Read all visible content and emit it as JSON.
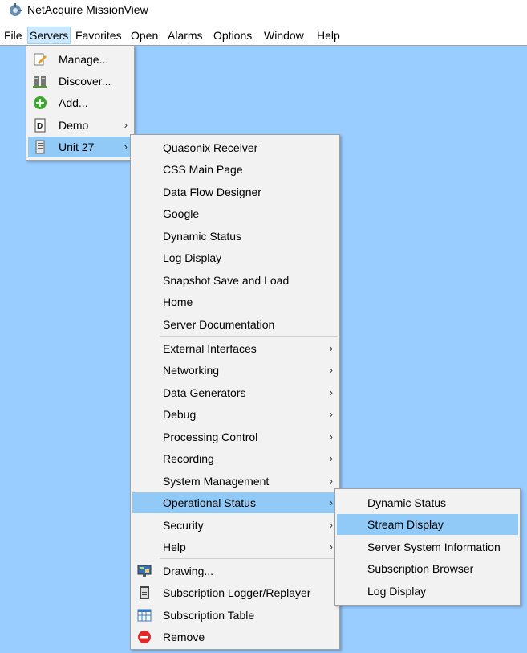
{
  "window": {
    "title": "NetAcquire MissionView"
  },
  "menubar": [
    "File",
    "Servers",
    "Favorites",
    "Open",
    "Alarms",
    "Options",
    "Window",
    "Help"
  ],
  "servers_menu": {
    "items": [
      {
        "label": "Manage...",
        "icon": "manage-icon"
      },
      {
        "label": "Discover...",
        "icon": "discover-icon"
      },
      {
        "label": "Add...",
        "icon": "add-icon"
      },
      {
        "label": "Demo",
        "icon": "demo-icon",
        "submenu": true
      },
      {
        "label": "Unit 27",
        "icon": "unit-icon",
        "submenu": true,
        "highlighted": true
      }
    ]
  },
  "unit_menu": {
    "group1": [
      "Quasonix Receiver",
      "CSS Main Page",
      "Data Flow Designer",
      "Google",
      "Dynamic Status",
      "Log Display",
      "Snapshot Save and Load",
      "Home",
      "Server Documentation"
    ],
    "group2": [
      "External Interfaces",
      "Networking",
      "Data Generators",
      "Debug",
      "Processing Control",
      "Recording",
      "System Management",
      "Operational Status",
      "Security",
      "Help"
    ],
    "group3": [
      {
        "label": "Drawing...",
        "icon": "drawing-icon"
      },
      {
        "label": "Subscription Logger/Replayer",
        "icon": "logger-icon"
      },
      {
        "label": "Subscription Table",
        "icon": "table-icon"
      },
      {
        "label": "Remove",
        "icon": "remove-icon"
      }
    ]
  },
  "status_menu": {
    "items": [
      "Dynamic Status",
      "Stream Display",
      "Server System Information",
      "Subscription Browser",
      "Log Display"
    ],
    "highlighted": "Stream Display"
  }
}
